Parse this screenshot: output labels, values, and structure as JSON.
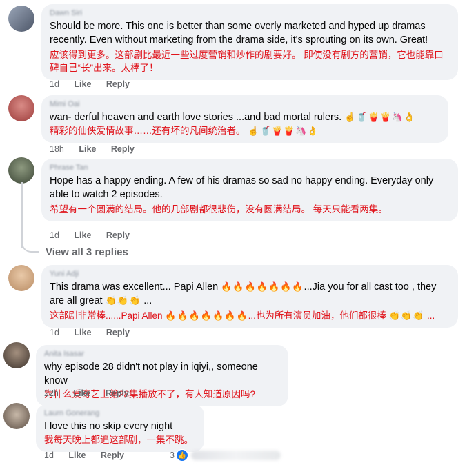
{
  "comments": [
    {
      "author": "Dawn Siri",
      "en": "Should be more. This one is better than some overly marketed and hyped up dramas recently. Even without marketing from the drama side, it's sprouting on its own. Great!",
      "zh": "应该得到更多。这部剧比最近一些过度营销和炒作的剧要好。 即使没有剧方的营销，它也能靠口碑自己“长”出来。太棒了！",
      "time": "1d",
      "like": "Like",
      "reply": "Reply"
    },
    {
      "author": "Mimi Oai",
      "en": "wan- derful heaven and earth love stories ...and bad mortal rulers.",
      "en_emoji": "☝️🥤🍟🍟🦄👌",
      "zh": "精彩的仙侠爱情故事……还有坏的凡间统治者。",
      "zh_emoji": "☝️🥤🍟🍟🦄👌",
      "time": "18h",
      "like": "Like",
      "reply": "Reply"
    },
    {
      "author": "Phrase Tan",
      "en": "Hope has a happy ending. A few of his dramas so sad no happy ending. Everyday only able to watch 2 episodes.",
      "zh": "希望有一个圆满的结局。他的几部剧都很悲伤，没有圆满结局。 每天只能看两集。",
      "time": "1d",
      "like": "Like",
      "reply": "Reply",
      "view_replies": "View all 3 replies"
    },
    {
      "author": "Yuni Adji",
      "en_a": "This drama was excellent... Papi Allen",
      "en_fire": "🔥🔥🔥🔥🔥🔥🔥",
      "en_b": "...Jia you for all cast too , they are all great",
      "en_claps": "👏👏👏",
      "en_c": "...",
      "zh_a": "这部剧非常棒......Papi Allen",
      "zh_fire": "🔥🔥🔥🔥🔥🔥🔥",
      "zh_b": "...也为所有演员加油，他们都很棒",
      "zh_claps": "👏👏👏",
      "zh_c": "...",
      "time": "1d",
      "like": "Like",
      "reply": "Reply"
    },
    {
      "author": "Anita Isasar",
      "en": "why episode 28 didn't not play in iqiyi,, someone know",
      "zh": "为什么爱奇艺上第28集播放不了，有人知道原因吗?",
      "time": "22h",
      "like": "Like",
      "reply": "Reply"
    },
    {
      "author": "Laurn Gonerang",
      "en": "I love this no skip every night",
      "zh": "我每天晚上都追这部剧，一集不跳。",
      "time": "1d",
      "like": "Like",
      "reply": "Reply",
      "reaction_count": "3"
    }
  ],
  "icons": {
    "like_reaction": "thumbs-up-icon"
  },
  "colors": {
    "accent": "#1877f2",
    "translation": "#e0141c"
  }
}
